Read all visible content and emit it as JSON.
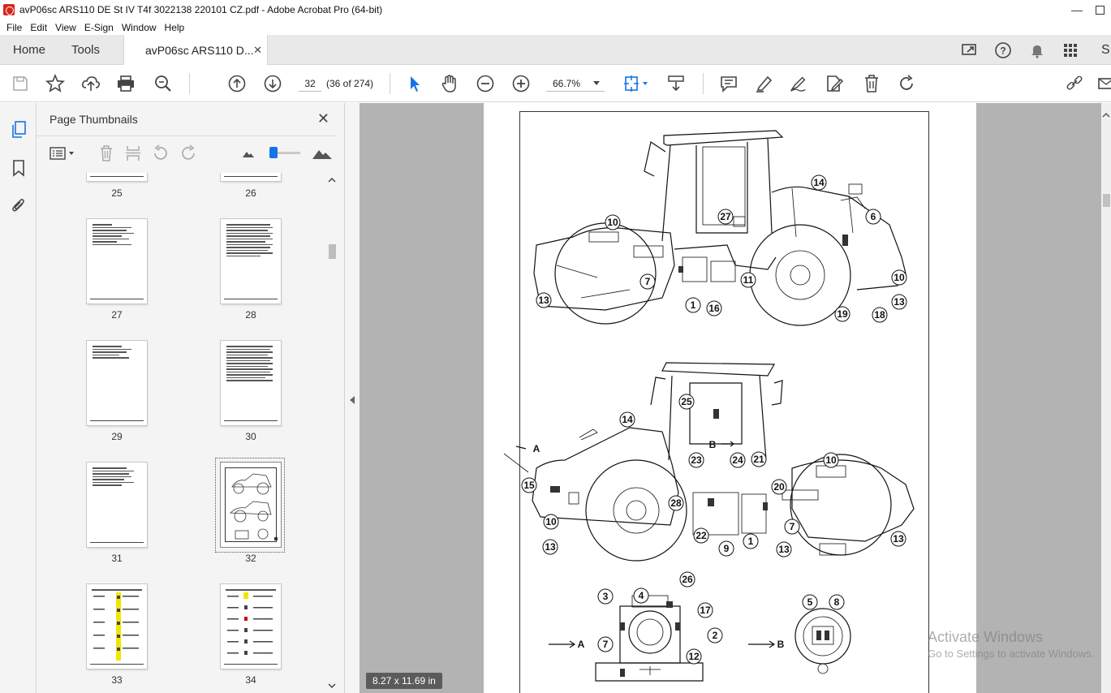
{
  "window": {
    "title": "avP06sc ARS110 DE St IV T4f 3022138 220101 CZ.pdf - Adobe Acrobat Pro (64-bit)",
    "minimize_glyph": "—",
    "close_glyph": "✕"
  },
  "menu": [
    "File",
    "Edit",
    "View",
    "E-Sign",
    "Window",
    "Help"
  ],
  "tabs": {
    "home": "Home",
    "tools": "Tools",
    "document": "avP06sc ARS110 D...",
    "close_glyph": "✕",
    "right_clip": "S"
  },
  "toolbar": {
    "page_number": "32",
    "page_count": "(36 of 274)",
    "zoom": "66.7%"
  },
  "panel": {
    "title": "Page Thumbnails",
    "close_glyph": "✕",
    "thumbnails": [
      {
        "label": "25"
      },
      {
        "label": "26"
      },
      {
        "label": "27"
      },
      {
        "label": "28"
      },
      {
        "label": "29"
      },
      {
        "label": "30"
      },
      {
        "label": "31"
      },
      {
        "label": "32"
      },
      {
        "label": "33"
      },
      {
        "label": "34"
      }
    ]
  },
  "document": {
    "page_size": "8.27 x 11.69 in",
    "view_labels": {
      "a": "A",
      "b": "B"
    },
    "callouts_top": [
      "14",
      "6",
      "27",
      "10",
      "7",
      "11",
      "10",
      "13",
      "1",
      "16",
      "19",
      "18",
      "13"
    ],
    "callouts_middle": [
      "25",
      "14",
      "B",
      "23",
      "24",
      "21",
      "10",
      "15",
      "20",
      "28",
      "7",
      "10",
      "22",
      "9",
      "1",
      "13",
      "13",
      "13",
      "A"
    ],
    "callouts_bottom": [
      "26",
      "4",
      "3",
      "17",
      "2",
      "12",
      "7",
      "5",
      "8",
      "A",
      "B"
    ]
  },
  "watermark": {
    "line1": "Activate Windows",
    "line2": "Go to Settings to activate Windows."
  },
  "colors": {
    "accent": "#1473e6",
    "app_red": "#d7261e",
    "canvas_gray": "#b3b3b3"
  },
  "icons": {
    "rail": [
      "page-thumbnails-icon",
      "bookmark-icon",
      "attachment-icon"
    ],
    "toolbar": [
      "save-icon",
      "star-icon",
      "upload-icon",
      "print-icon",
      "find-icon",
      "prev-page-icon",
      "next-page-icon",
      "select-cursor-icon",
      "hand-icon",
      "zoom-out-icon",
      "zoom-in-icon",
      "fit-page-icon",
      "scroll-mode-icon",
      "comment-icon",
      "highlight-icon",
      "sign-icon",
      "edit-pdf-icon",
      "delete-icon",
      "rotate-icon",
      "share-link-icon"
    ]
  }
}
